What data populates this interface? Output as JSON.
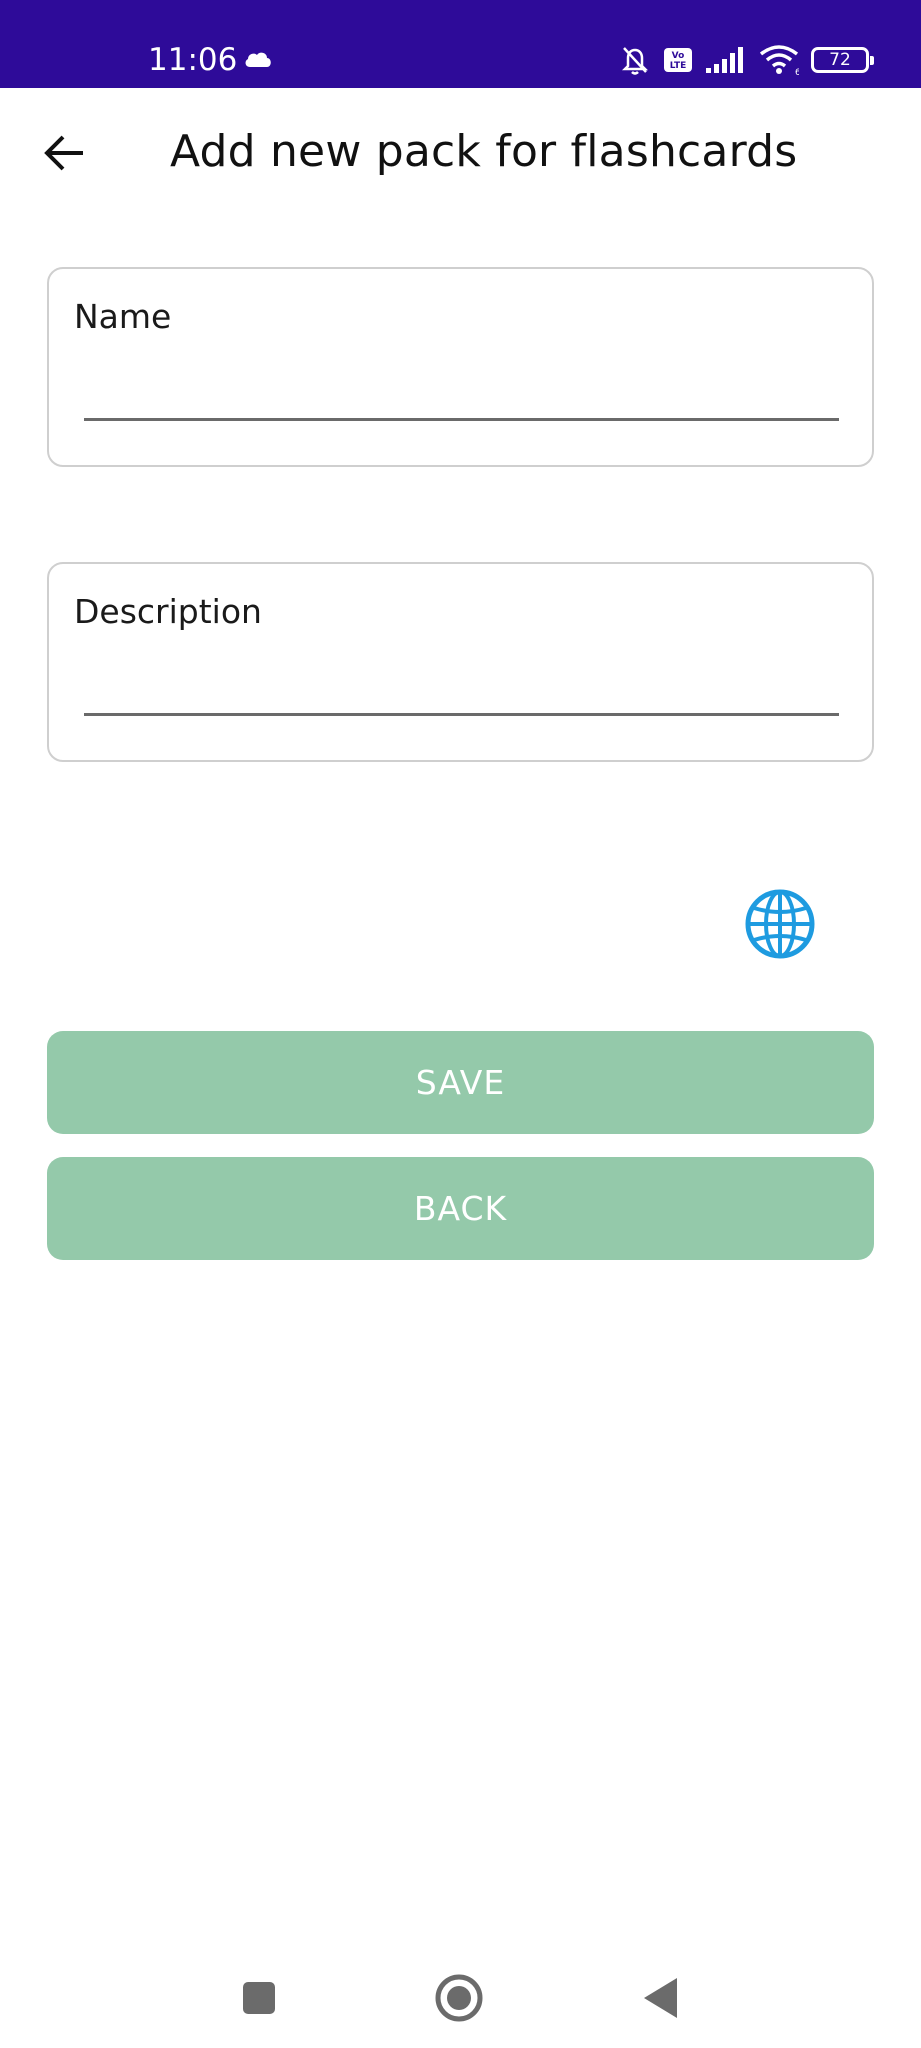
{
  "status_bar": {
    "time": "11:06",
    "battery_level": "72",
    "icons": [
      "cloud-icon",
      "mute-notifications-icon",
      "volte-icon",
      "signal-icon",
      "wifi-icon",
      "battery-icon"
    ],
    "background_color": "#2e0b99"
  },
  "app_bar": {
    "title": "Add new pack for flashcards",
    "back_icon": "arrow-left-icon"
  },
  "form": {
    "name": {
      "label": "Name",
      "value": ""
    },
    "description": {
      "label": "Description",
      "value": ""
    }
  },
  "language_icon": "globe-icon",
  "buttons": {
    "save_label": "SAVE",
    "back_label": "BACK",
    "color": "#94c9aa"
  },
  "nav_bar": {
    "icons": [
      "recent-apps-icon",
      "home-icon",
      "back-triangle-icon"
    ]
  }
}
